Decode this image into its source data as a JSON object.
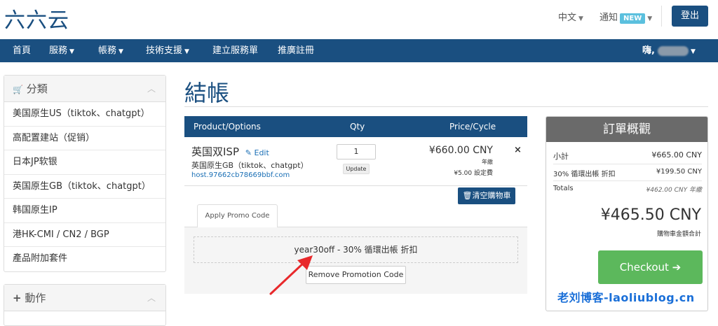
{
  "header": {
    "logo": "六六云",
    "language": "中文",
    "notifications": "通知",
    "new_badge": "NEW",
    "logout": "登出"
  },
  "nav": {
    "items": [
      "首頁",
      "服務",
      "帳務",
      "技術支援",
      "建立服務單",
      "推廣註冊"
    ],
    "user_greeting": "嗨,"
  },
  "sidebar": {
    "categories_title": "分類",
    "categories": [
      "美国原生US（tiktok、chatgpt）",
      "高配置建站（促销）",
      "日本JP软银",
      "英国原生GB（tiktok、chatgpt）",
      "韩国原生IP",
      "港HK-CMI / CN2 / BGP",
      "產品附加套件"
    ],
    "actions_title": "動作"
  },
  "page": {
    "title": "結帳"
  },
  "cart": {
    "columns": [
      "Product/Options",
      "Qty",
      "Price/Cycle"
    ],
    "item": {
      "name": "英国双ISP",
      "edit_label": "Edit",
      "description": "英国原生GB（tiktok、chatgpt）",
      "hostname": "host.97662cb78669bbf.com",
      "qty": "1",
      "update_label": "Update",
      "price": "¥660.00 CNY",
      "cycle": "年繳",
      "setup_fee": "¥5.00 設定費",
      "remove_symbol": "×"
    },
    "empty_cart_label": "清空購物車"
  },
  "promo": {
    "tab_label": "Apply Promo Code",
    "applied_code": "year30off - 30% 循環出帳 折扣",
    "remove_label": "Remove Promotion Code"
  },
  "summary": {
    "title": "訂單概觀",
    "subtotal_label": "小計",
    "subtotal_value": "¥665.00 CNY",
    "discount_label": "30% 循環出帳 折扣",
    "discount_value": "¥199.50 CNY",
    "totals_label": "Totals",
    "totals_value": "¥462.00 CNY 年繳",
    "total_due": "¥465.50 CNY",
    "total_due_note": "購物車金額合計",
    "checkout_label": "Checkout ➔"
  },
  "watermark": "老刘博客-laoliublog.cn",
  "colors": {
    "brand": "#1a4f80",
    "checkout_green": "#5cb85c",
    "new_badge": "#5bc0de",
    "annotation_arrow": "#e8282b"
  }
}
